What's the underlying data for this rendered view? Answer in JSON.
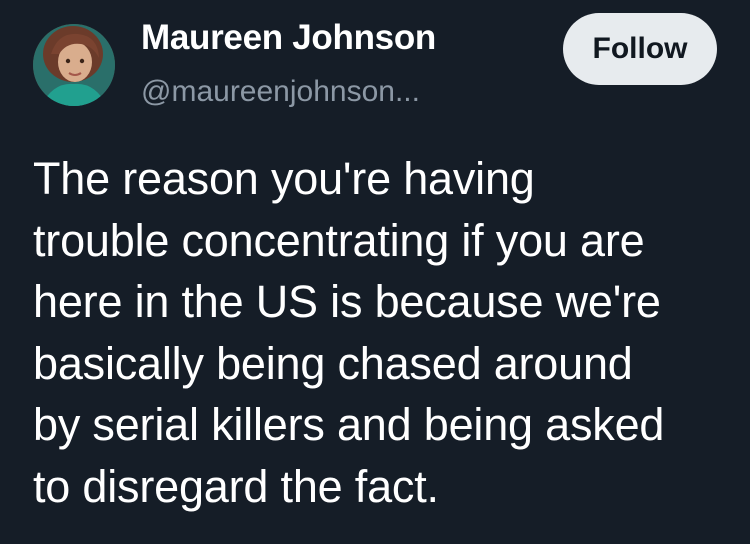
{
  "author": {
    "display_name": "Maureen Johnson",
    "handle": "@maureenjohnson..."
  },
  "follow_button": {
    "label": "Follow"
  },
  "tweet": {
    "lines": [
      "The reason you're having",
      "trouble concentrating if you are",
      "here in the US is because we're",
      "basically being chased around",
      "by serial killers and being asked",
      "to disregard the fact."
    ]
  },
  "colors": {
    "background": "#151d27",
    "text": "#ffffff",
    "handle": "#8c98a5",
    "button_bg": "#e7ebee",
    "button_text": "#111820"
  },
  "icons": {
    "avatar": "profile-photo"
  }
}
